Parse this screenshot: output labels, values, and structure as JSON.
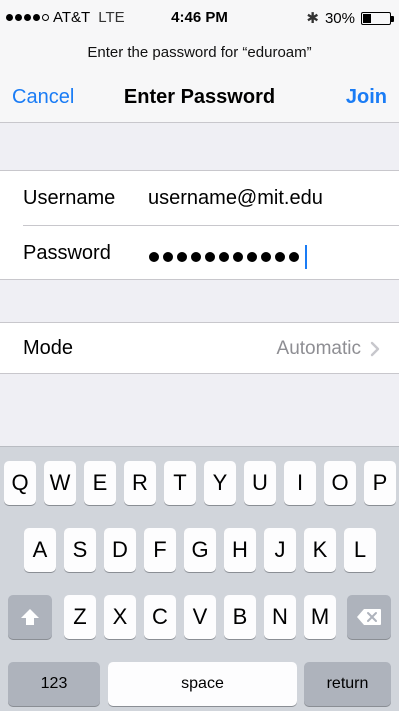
{
  "status": {
    "carrier": "AT&T",
    "network": "LTE",
    "time": "4:46 PM",
    "battery": "30%",
    "battery_level": 0.3,
    "signal_bars": 4
  },
  "prompt": "Enter the password for “eduroam”",
  "nav": {
    "cancel": "Cancel",
    "title": "Enter Password",
    "join": "Join"
  },
  "fields": {
    "username_label": "Username",
    "username_value": "username@mit.edu",
    "password_label": "Password",
    "password_length": 11
  },
  "mode": {
    "label": "Mode",
    "value": "Automatic"
  },
  "keyboard": {
    "row1": [
      "Q",
      "W",
      "E",
      "R",
      "T",
      "Y",
      "U",
      "I",
      "O",
      "P"
    ],
    "row2": [
      "A",
      "S",
      "D",
      "F",
      "G",
      "H",
      "J",
      "K",
      "L"
    ],
    "row3": [
      "Z",
      "X",
      "C",
      "V",
      "B",
      "N",
      "M"
    ],
    "numbers": "123",
    "space": "space",
    "return": "return",
    "shift_icon": "shift-arrow-icon",
    "delete_icon": "backspace-icon"
  },
  "colors": {
    "accent": "#1a7cf5",
    "keyboard_bg": "#d1d5db",
    "secondary_text": "#8e8e93"
  }
}
